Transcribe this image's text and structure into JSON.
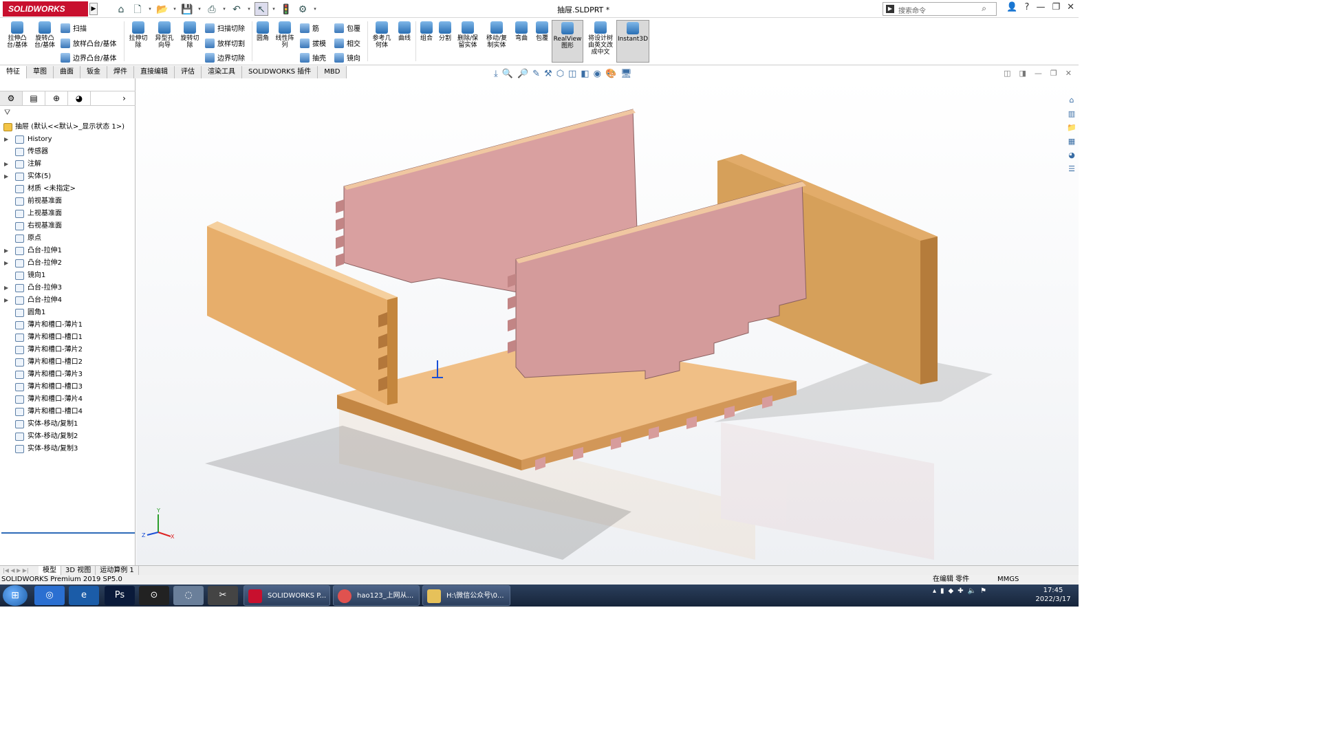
{
  "app": {
    "name": "SOLIDWORKS",
    "doc_title": "抽屉.SLDPRT *"
  },
  "search": {
    "placeholder": "搜索命令"
  },
  "ribbon": {
    "extrude_boss": "拉伸凸\n台/基体",
    "revolve_boss": "旋转凸\n台/基体",
    "sweep": "扫描",
    "loft_boss": "放样凸台/基体",
    "boundary_boss": "边界凸台/基体",
    "extrude_cut": "拉伸切\n除",
    "hole_wizard": "异型孔\n向导",
    "revolve_cut": "旋转切\n除",
    "sweep_cut": "扫描切除",
    "loft_cut": "放样切割",
    "boundary_cut": "边界切除",
    "fillet": "圆角",
    "linear_pattern": "线性阵\n列",
    "rib": "筋",
    "draft": "拔模",
    "shell": "抽壳",
    "wrap": "包覆",
    "intersect": "相交",
    "mirror": "镜向",
    "ref_geometry": "参考几\n何体",
    "curves": "曲线",
    "combine": "组合",
    "split": "分割",
    "delete_keep": "删除/保\n留实体",
    "move_copy": "移动/复\n制实体",
    "flex": "弯曲",
    "wrap2": "包覆",
    "realview": "RealView\n图形",
    "translate_tree": "将设计树\n由英文改\n成中文",
    "instant3d": "Instant3D"
  },
  "tabs": [
    "特征",
    "草图",
    "曲面",
    "钣金",
    "焊件",
    "直接编辑",
    "评估",
    "渲染工具",
    "SOLIDWORKS 插件",
    "MBD"
  ],
  "tree": {
    "root": "抽屉  (默认<<默认>_显示状态 1>)",
    "nodes": [
      "History",
      "传感器",
      "注解",
      "实体(5)",
      "材质 <未指定>",
      "前视基准面",
      "上视基准面",
      "右视基准面",
      "原点",
      "凸台-拉伸1",
      "凸台-拉伸2",
      "镜向1",
      "凸台-拉伸3",
      "凸台-拉伸4",
      "圆角1",
      "薄片和槽口-薄片1",
      "薄片和槽口-槽口1",
      "薄片和槽口-薄片2",
      "薄片和槽口-槽口2",
      "薄片和槽口-薄片3",
      "薄片和槽口-槽口3",
      "薄片和槽口-薄片4",
      "薄片和槽口-槽口4",
      "实体-移动/复制1",
      "实体-移动/复制2",
      "实体-移动/复制3"
    ]
  },
  "bottom_tabs": [
    "模型",
    "3D 视图",
    "运动算例 1"
  ],
  "status": {
    "left": "SOLIDWORKS Premium 2019 SP5.0",
    "edit": "在编辑 零件",
    "units": "MMGS"
  },
  "taskbar": {
    "tasks": [
      "SOLIDWORKS P...",
      "hao123_上网从...",
      "H:\\微信公众号\\0..."
    ],
    "time": "17:45",
    "date": "2022/3/17"
  },
  "triad": {
    "x": "X",
    "y": "Y",
    "z": "Z"
  },
  "colors": {
    "accent": "#c8102e",
    "wood": "#e8b27a",
    "pink": "#d9a0a0"
  }
}
